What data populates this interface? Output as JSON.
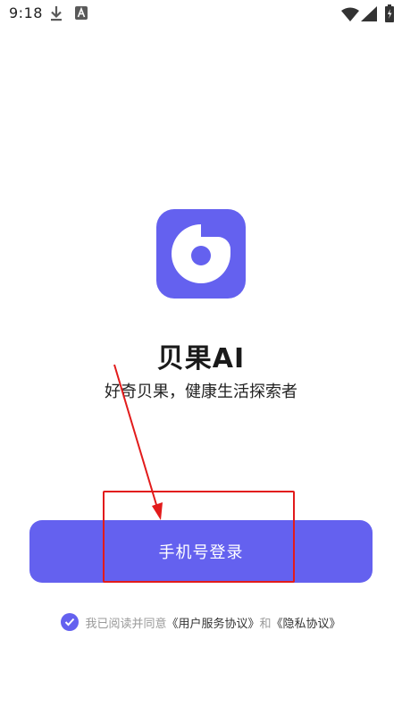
{
  "status_bar": {
    "time": "9:18",
    "icons": [
      "download-icon",
      "a-badge-icon",
      "wifi-icon",
      "signal-icon",
      "battery-icon"
    ]
  },
  "app": {
    "name": "贝果AI",
    "slogan": "好奇贝果，健康生活探索者",
    "brand_color": "#6461ef"
  },
  "login": {
    "button_label": "手机号登录"
  },
  "agreement": {
    "checked": true,
    "prefix": "我已阅读并同意",
    "user_agreement_link": "《用户服务协议》",
    "conjunction": "和",
    "privacy_link": "《隐私协议》"
  },
  "annotation": {
    "color": "#e21b1b"
  }
}
